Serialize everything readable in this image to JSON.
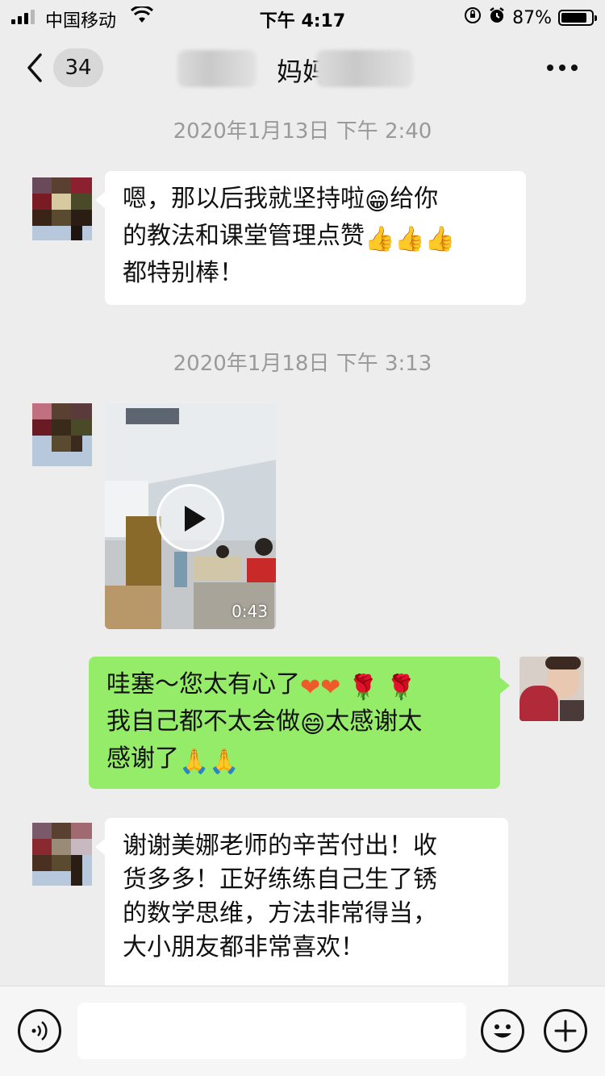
{
  "status_bar": {
    "carrier": "中国移动",
    "time": "下午 4:17",
    "battery_percent": "87%",
    "battery_level": 0.87
  },
  "nav": {
    "back_count": "34",
    "title": "妈妈"
  },
  "messages": [
    {
      "timestamp": "2020年1月13日 下午 2:40",
      "sender": "other",
      "lines": [
        "嗯，那以后我就坚持啦",
        "给你",
        "的教法和课堂管理点赞",
        "都特别棒！"
      ]
    },
    {
      "timestamp": "2020年1月18日 下午 3:13",
      "sender": "other",
      "type": "video",
      "duration": "0:43"
    },
    {
      "sender": "me",
      "lines": [
        "哇塞～您太有心了",
        "我自己都不太会做",
        "太感谢太",
        "感谢了"
      ]
    },
    {
      "sender": "other",
      "lines": [
        "谢谢美娜老师的辛苦付出！收",
        "货多多！正好练练自己生了锈",
        "的数学思维，方法非常得当，",
        "大小朋友都非常喜欢！"
      ]
    }
  ],
  "icons": {
    "grin_emoji": "😁",
    "thumbs_up_emoji": "👍",
    "heart_emoji": "❤",
    "rose_emoji": "🌹",
    "smile_emoji": "😄",
    "pray_emoji": "🙏"
  },
  "colors": {
    "my_bubble": "#95ec69",
    "other_bubble": "#ffffff",
    "background": "#ededed"
  }
}
